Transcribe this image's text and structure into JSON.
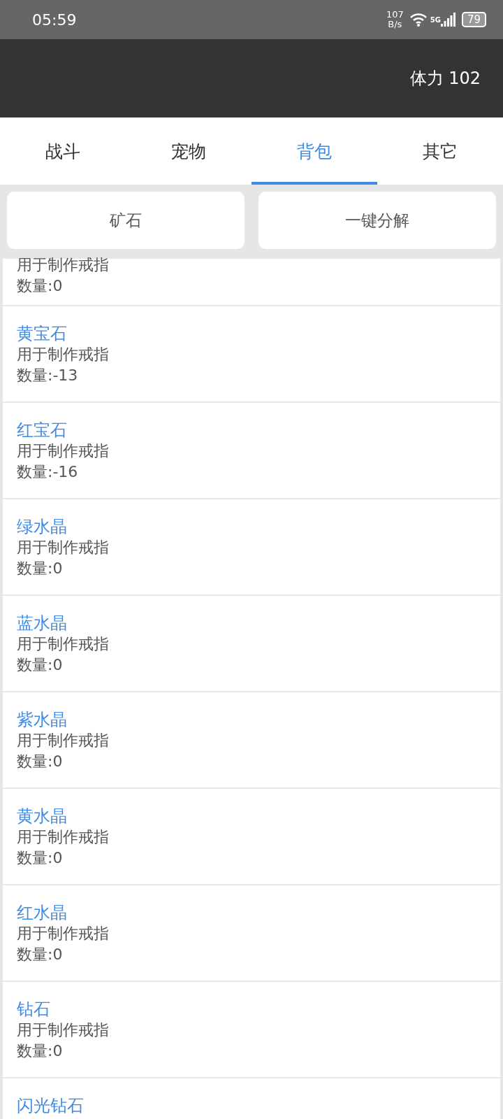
{
  "status_bar": {
    "time": "05:59",
    "net_speed_value": "107",
    "net_speed_unit": "B/s",
    "network": "5G",
    "battery": "79"
  },
  "header": {
    "stamina": "体力 102"
  },
  "tabs": [
    {
      "label": "战斗",
      "selected": false
    },
    {
      "label": "宠物",
      "selected": false
    },
    {
      "label": "背包",
      "selected": true
    },
    {
      "label": "其它",
      "selected": false
    }
  ],
  "actions": [
    "矿石",
    "一键分解"
  ],
  "items": [
    {
      "cut": true,
      "description": "用于制作戒指",
      "count": "数量:0"
    },
    {
      "cut": false,
      "name": "黄宝石",
      "description": "用于制作戒指",
      "count": "数量:-13"
    },
    {
      "cut": false,
      "name": "红宝石",
      "description": "用于制作戒指",
      "count": "数量:-16"
    },
    {
      "cut": false,
      "name": "绿水晶",
      "description": "用于制作戒指",
      "count": "数量:0"
    },
    {
      "cut": false,
      "name": "蓝水晶",
      "description": "用于制作戒指",
      "count": "数量:0"
    },
    {
      "cut": false,
      "name": "紫水晶",
      "description": "用于制作戒指",
      "count": "数量:0"
    },
    {
      "cut": false,
      "name": "黄水晶",
      "description": "用于制作戒指",
      "count": "数量:0"
    },
    {
      "cut": false,
      "name": "红水晶",
      "description": "用于制作戒指",
      "count": "数量:0"
    },
    {
      "cut": false,
      "name": "钻石",
      "description": "用于制作戒指",
      "count": "数量:0"
    },
    {
      "cut": false,
      "name": "闪光钻石"
    }
  ]
}
